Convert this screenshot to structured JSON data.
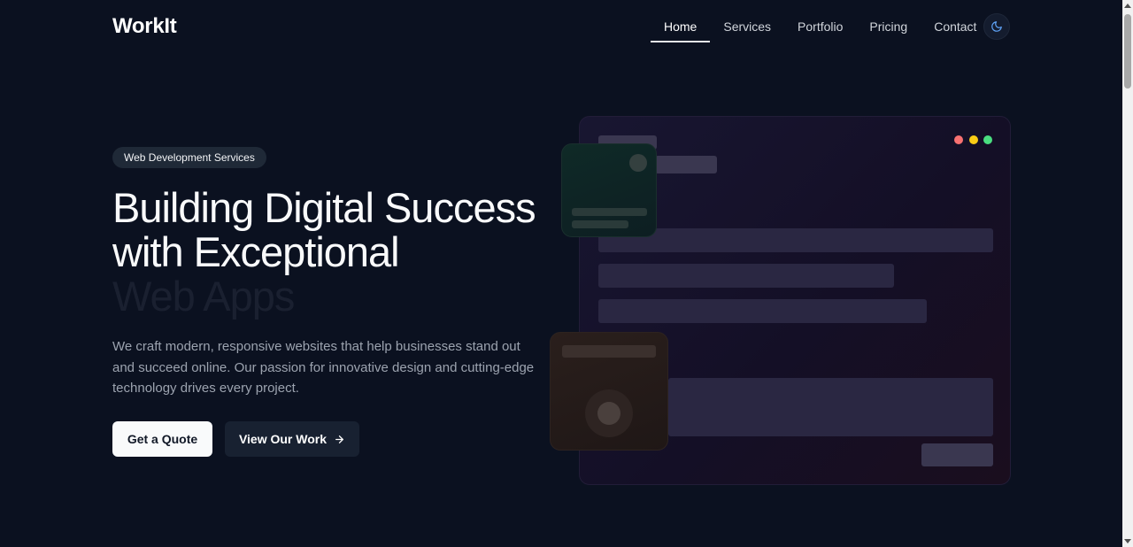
{
  "header": {
    "logo": "WorkIt",
    "nav": [
      {
        "label": "Home",
        "active": true
      },
      {
        "label": "Services"
      },
      {
        "label": "Portfolio"
      },
      {
        "label": "Pricing"
      },
      {
        "label": "Contact"
      }
    ],
    "theme_icon": "moon-icon"
  },
  "hero": {
    "badge": "Web Development Services",
    "title_line1": "Building Digital Success",
    "title_line2": "with Exceptional",
    "title_line3": "Web Apps",
    "description": "We craft modern, responsive websites that help businesses stand out and succeed online. Our passion for innovative design and cutting-edge technology drives every project.",
    "primary_button": "Get a Quote",
    "secondary_button": "View Our Work",
    "secondary_icon": "arrow-right-icon"
  },
  "mockup": {
    "window_dot_colors": [
      "#f87171",
      "#facc15",
      "#4ade80"
    ]
  }
}
